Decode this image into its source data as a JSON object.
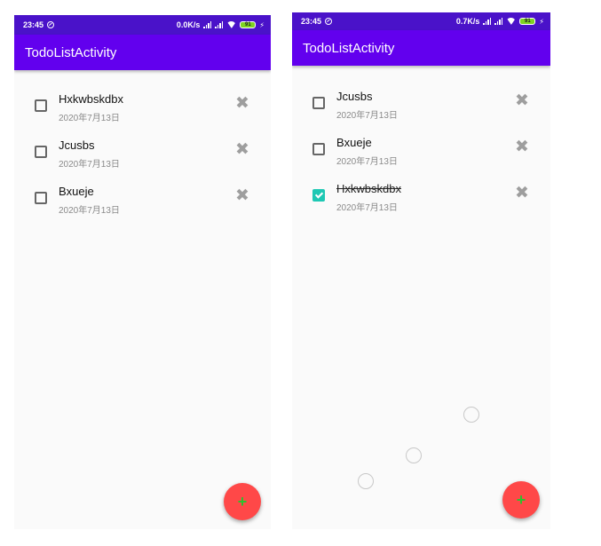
{
  "colors": {
    "status_bar": "#4a12c9",
    "app_bar": "#6200ee",
    "checked": "#1ec8b4",
    "fab": "#ff4848",
    "fab_icon": "#2ec02e",
    "delete_icon": "#9e9e9e"
  },
  "left_screen": {
    "status": {
      "time": "23:45",
      "network_speed": "0.0K/s",
      "battery": "91"
    },
    "app_title": "TodoListActivity",
    "items": [
      {
        "title": "Hxkwbskdbx",
        "date": "2020年7月13日",
        "checked": false,
        "delete_icon": "close-icon"
      },
      {
        "title": "Jcusbs",
        "date": "2020年7月13日",
        "checked": false,
        "delete_icon": "close-icon"
      },
      {
        "title": "Bxueje",
        "date": "2020年7月13日",
        "checked": false,
        "delete_icon": "close-icon"
      }
    ],
    "fab_icon": "+"
  },
  "right_screen": {
    "status": {
      "time": "23:45",
      "network_speed": "0.7K/s",
      "battery": "91"
    },
    "app_title": "TodoListActivity",
    "items": [
      {
        "title": "Jcusbs",
        "date": "2020年7月13日",
        "checked": false,
        "delete_icon": "close-icon"
      },
      {
        "title": "Bxueje",
        "date": "2020年7月13日",
        "checked": false,
        "delete_icon": "close-icon"
      },
      {
        "title": "Hxkwbskdbx",
        "date": "2020年7月13日",
        "checked": true,
        "delete_icon": "close-icon"
      }
    ],
    "fab_icon": "+"
  }
}
